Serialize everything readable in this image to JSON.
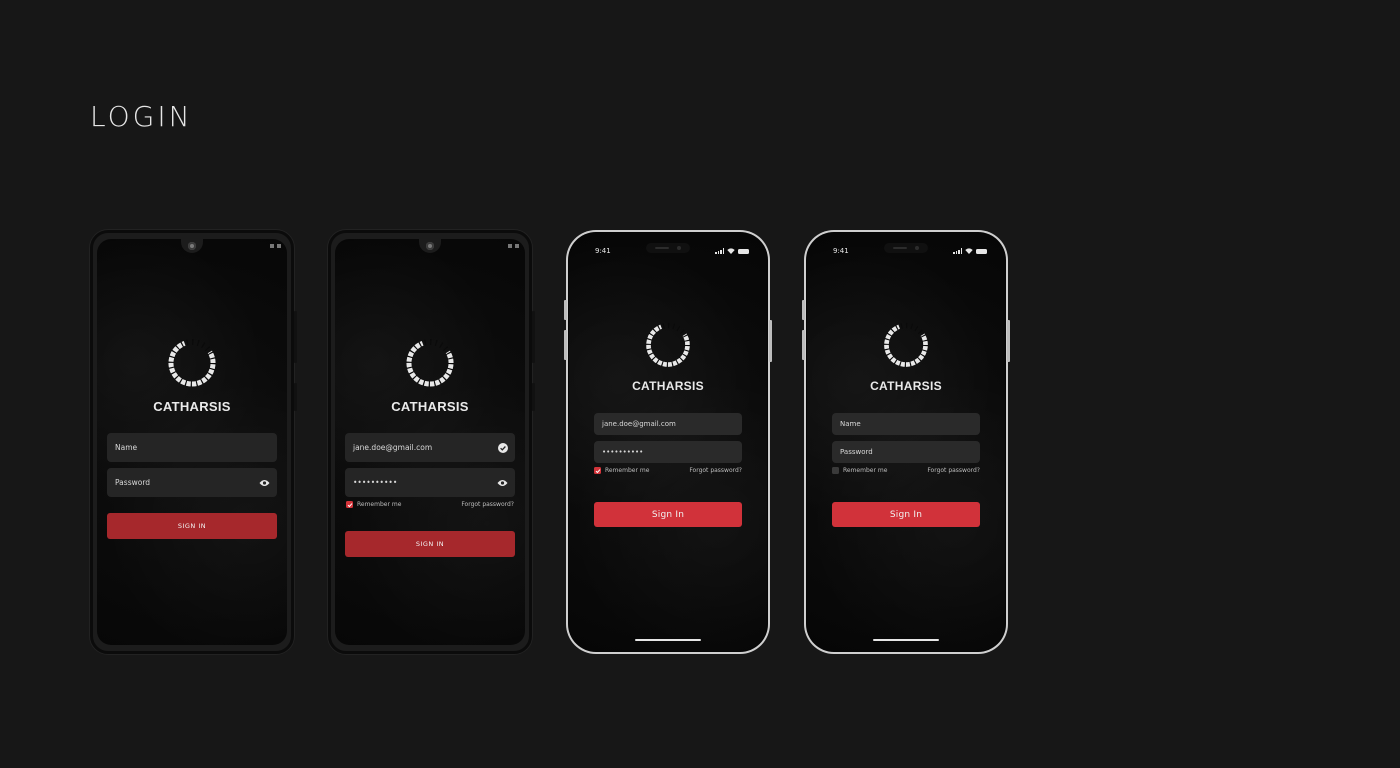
{
  "page": {
    "title": "LOGIN"
  },
  "brand": "CATHARSIS",
  "colors": {
    "accent": "#d1323a",
    "android_button": "#a6282c",
    "background": "#171717"
  },
  "screens": [
    {
      "platform": "android",
      "fields": [
        {
          "value": "Name",
          "icon": ""
        },
        {
          "value": "Password",
          "icon": "eye-icon"
        }
      ],
      "button": "SIGN IN"
    },
    {
      "platform": "android",
      "fields": [
        {
          "value": "jane.doe@gmail.com",
          "icon": "check-circle-icon"
        },
        {
          "value": "••••••••••",
          "icon": "eye-icon"
        }
      ],
      "remember": {
        "label": "Remember me",
        "checked": true
      },
      "forgot": "Forgot password?",
      "button": "SIGN IN"
    },
    {
      "platform": "ios",
      "time": "9:41",
      "fields": [
        {
          "value": "jane.doe@gmail.com"
        },
        {
          "value": "••••••••••"
        }
      ],
      "remember": {
        "label": "Remember me",
        "checked": true
      },
      "forgot": "Forgot password?",
      "button": "Sign In"
    },
    {
      "platform": "ios",
      "time": "9:41",
      "fields": [
        {
          "value": "Name"
        },
        {
          "value": "Password"
        }
      ],
      "remember": {
        "label": "Remember me",
        "checked": false
      },
      "forgot": "Forgot password?",
      "button": "Sign In"
    }
  ]
}
